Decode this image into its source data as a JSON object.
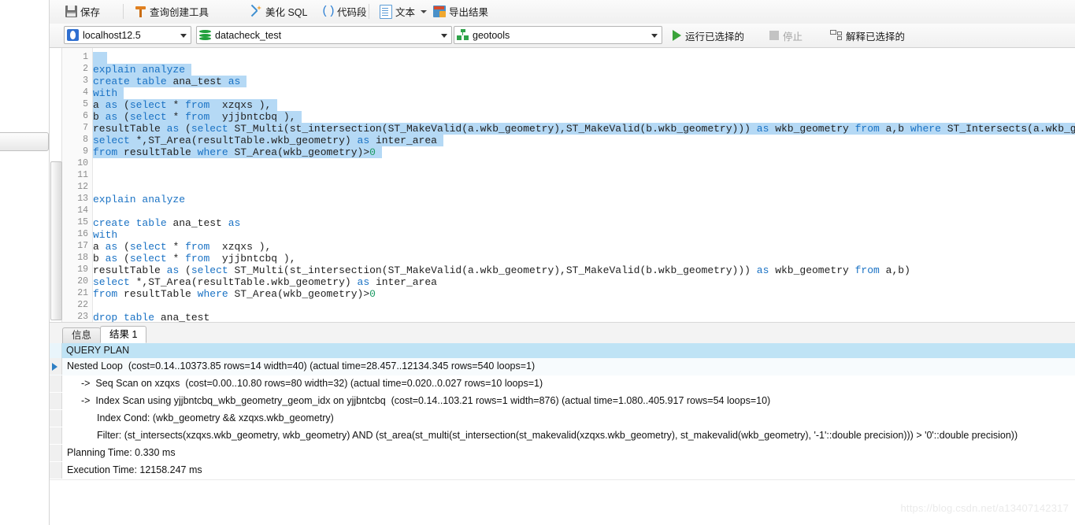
{
  "toolbar_main": {
    "items": [
      {
        "label": "保存",
        "icon": "save-icon",
        "name": "save-button"
      },
      {
        "label": "查询创建工具",
        "icon": "query-builder-icon",
        "name": "query-builder-button"
      },
      {
        "label": "美化 SQL",
        "icon": "beautify-icon",
        "name": "beautify-sql-button"
      },
      {
        "label": "代码段",
        "icon": "code-snippet-icon",
        "name": "code-snippet-button"
      },
      {
        "label": "文本",
        "icon": "text-icon",
        "name": "text-format-button"
      },
      {
        "label": "导出结果",
        "icon": "export-icon",
        "name": "export-result-button"
      }
    ]
  },
  "connection_bar": {
    "server": "localhost12.5",
    "database": "datacheck_test",
    "schema": "geotools",
    "extra_value": "",
    "run_selected_label": "运行已选择的",
    "stop_label": "停止",
    "explain_selected_label": "解释已选择的"
  },
  "editor": {
    "line_numbers": [
      1,
      2,
      3,
      4,
      5,
      6,
      7,
      8,
      9,
      10,
      11,
      12,
      13,
      14,
      15,
      16,
      17,
      18,
      19,
      20,
      21,
      22,
      23
    ],
    "lines": [
      {
        "n": 1,
        "text": "",
        "selected": true
      },
      {
        "n": 2,
        "text": "explain analyze",
        "selected": true
      },
      {
        "n": 3,
        "text": "create table ana_test as",
        "selected": true
      },
      {
        "n": 4,
        "text": "with",
        "selected": true
      },
      {
        "n": 5,
        "text": "a as (select * from  xzqxs ),",
        "selected": true
      },
      {
        "n": 6,
        "text": "b as (select * from  yjjbntcbq ),",
        "selected": true
      },
      {
        "n": 7,
        "text": "resultTable as (select ST_Multi(st_intersection(ST_MakeValid(a.wkb_geometry),ST_MakeValid(b.wkb_geometry))) as wkb_geometry from a,b where ST_Intersects(a.wkb_geometry,b.wkb_ge",
        "selected": true
      },
      {
        "n": 8,
        "text": "select *,ST_Area(resultTable.wkb_geometry) as inter_area",
        "selected": true
      },
      {
        "n": 9,
        "text": "from resultTable where ST_Area(wkb_geometry)>0",
        "selected": true
      },
      {
        "n": 10,
        "text": "",
        "selected": false
      },
      {
        "n": 11,
        "text": "",
        "selected": false
      },
      {
        "n": 12,
        "text": "",
        "selected": false
      },
      {
        "n": 13,
        "text": "explain analyze",
        "selected": false
      },
      {
        "n": 14,
        "text": "",
        "selected": false
      },
      {
        "n": 15,
        "text": "create table ana_test as",
        "selected": false
      },
      {
        "n": 16,
        "text": "with",
        "selected": false
      },
      {
        "n": 17,
        "text": "a as (select * from  xzqxs ),",
        "selected": false
      },
      {
        "n": 18,
        "text": "b as (select * from  yjjbntcbq ),",
        "selected": false
      },
      {
        "n": 19,
        "text": "resultTable as (select ST_Multi(st_intersection(ST_MakeValid(a.wkb_geometry),ST_MakeValid(b.wkb_geometry))) as wkb_geometry from a,b)",
        "selected": false
      },
      {
        "n": 20,
        "text": "select *,ST_Area(resultTable.wkb_geometry) as inter_area",
        "selected": false
      },
      {
        "n": 21,
        "text": "from resultTable where ST_Area(wkb_geometry)>0",
        "selected": false
      },
      {
        "n": 22,
        "text": "",
        "selected": false
      },
      {
        "n": 23,
        "text": "drop table ana_test",
        "selected": false
      }
    ]
  },
  "result_tabs": [
    {
      "label": "信息",
      "active": false,
      "name": "tab-info"
    },
    {
      "label": "结果 1",
      "active": true,
      "name": "tab-result-1"
    }
  ],
  "query_plan": {
    "column_header": "QUERY PLAN",
    "rows": [
      {
        "indent": 0,
        "text": "Nested Loop  (cost=0.14..10373.85 rows=14 width=40) (actual time=28.457..12134.345 rows=540 loops=1)",
        "selected": true
      },
      {
        "indent": 1,
        "text": "->  Seq Scan on xzqxs  (cost=0.00..10.80 rows=80 width=32) (actual time=0.020..0.027 rows=10 loops=1)",
        "selected": false
      },
      {
        "indent": 1,
        "text": "->  Index Scan using yjjbntcbq_wkb_geometry_geom_idx on yjjbntcbq  (cost=0.14..103.21 rows=1 width=876) (actual time=1.080..405.917 rows=54 loops=10)",
        "selected": false
      },
      {
        "indent": 2,
        "text": "Index Cond: (wkb_geometry && xzqxs.wkb_geometry)",
        "selected": false
      },
      {
        "indent": 2,
        "text": "Filter: (st_intersects(xzqxs.wkb_geometry, wkb_geometry) AND (st_area(st_multi(st_intersection(st_makevalid(xzqxs.wkb_geometry), st_makevalid(wkb_geometry), '-1'::double precision))) > '0'::double precision))",
        "selected": false
      },
      {
        "indent": 0,
        "text": "Planning Time: 0.330 ms",
        "selected": false
      },
      {
        "indent": 0,
        "text": "Execution Time: 12158.247 ms",
        "selected": false
      }
    ]
  },
  "watermark": "https://blog.csdn.net/a13407142317",
  "colors": {
    "keyword": "#1a72c4",
    "number": "#1a9a62",
    "selection": "#b5d9f5",
    "grid_header": "#bfe3f5",
    "run_green": "#3aa33a"
  }
}
